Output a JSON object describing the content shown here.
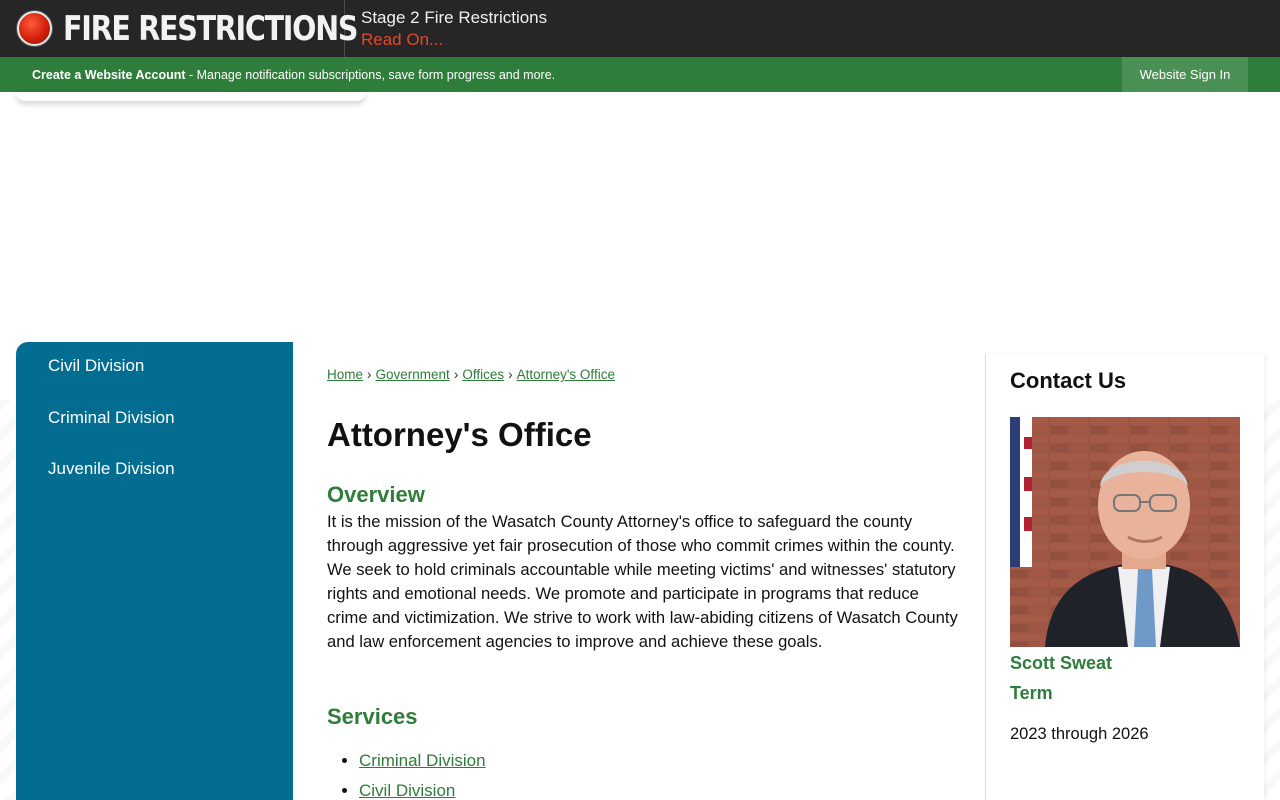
{
  "alert": {
    "title": "FIRE RESTRICTIONS",
    "message_title": "Stage 2 Fire Restrictions",
    "message_link": "Read On..."
  },
  "account_bar": {
    "create_label": "Create a Website Account",
    "create_desc": " - Manage notification subscriptions, save form progress and more.",
    "signin_label": "Website Sign In"
  },
  "sidebar": {
    "items": [
      {
        "label": "Civil Division"
      },
      {
        "label": "Criminal Division"
      },
      {
        "label": "Juvenile Division"
      }
    ]
  },
  "breadcrumb": {
    "items": [
      {
        "label": "Home"
      },
      {
        "label": "Government"
      },
      {
        "label": "Offices"
      },
      {
        "label": "Attorney's Office"
      }
    ],
    "separator": "›"
  },
  "main": {
    "title": "Attorney's Office",
    "overview_heading": "Overview",
    "overview_text": "It is the mission of the Wasatch County Attorney's office to safeguard the county through aggressive yet fair prosecution of those who commit crimes within the county. We seek to hold criminals accountable while meeting victims' and witnesses' statutory rights and emotional needs. We promote and participate in programs that reduce crime and victimization. We strive to work with law-abiding citizens of Wasatch County and law enforcement agencies to improve and achieve these goals.",
    "services_heading": "Services",
    "services": [
      {
        "label": "Criminal Division"
      },
      {
        "label": "Civil Division"
      }
    ]
  },
  "contact": {
    "title": "Contact Us",
    "name": "Scott Sweat",
    "term_label": "Term",
    "term_value": "2023 through 2026"
  },
  "colors": {
    "alert_bg": "#262626",
    "accent_green": "#2e7d3a",
    "sidebar_blue": "#036d91",
    "alert_red": "#e8452a"
  }
}
